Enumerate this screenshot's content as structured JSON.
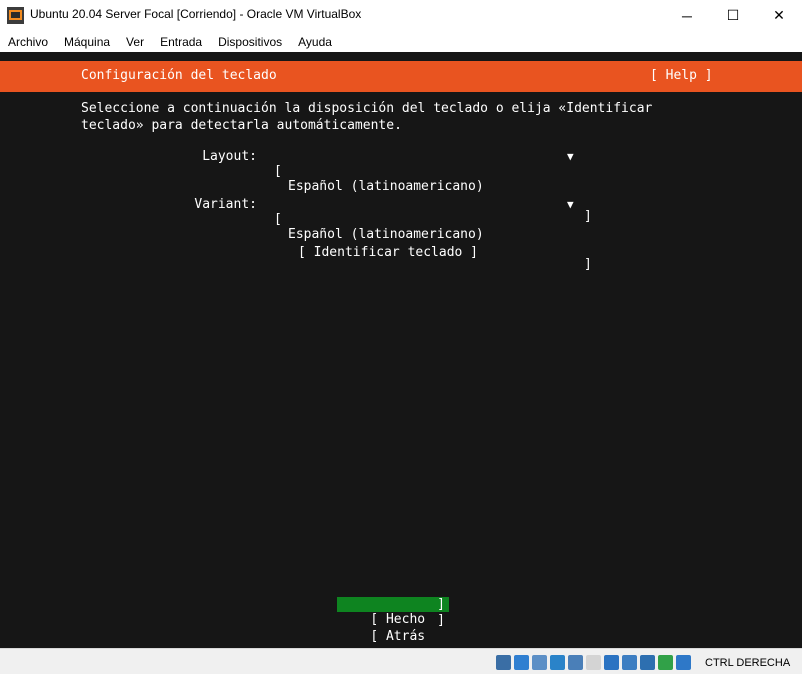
{
  "window": {
    "title": "Ubuntu 20.04 Server Focal [Corriendo] - Oracle VM VirtualBox",
    "minimize_glyph": "─",
    "maximize_glyph": "☐",
    "close_glyph": "✕"
  },
  "menu": [
    "Archivo",
    "Máquina",
    "Ver",
    "Entrada",
    "Dispositivos",
    "Ayuda"
  ],
  "installer": {
    "header_title": "Configuración del teclado",
    "help_label": "[ Help ]",
    "description": "Seleccione a continuación la disposición del teclado o elija «Identificar\nteclado» para detectarla automáticamente.",
    "layout": {
      "label": "Layout:",
      "value": "Español (latinoamericano)",
      "open": "[",
      "close": "]",
      "arrow": "▼"
    },
    "variant": {
      "label": "Variant:",
      "value": "Español (latinoamericano)",
      "open": "[",
      "close": "]",
      "arrow": "▼"
    },
    "identify_button": "[ Identificar teclado ]",
    "done_button": "[ Hecho",
    "back_button": "[ Atrás",
    "button_close": "]"
  },
  "statusbar": {
    "host_key": "CTRL DERECHA",
    "icons": [
      {
        "name": "hard-disk-icon",
        "color": "#3a6ea5"
      },
      {
        "name": "optical-drive-icon",
        "color": "#2f7fd1"
      },
      {
        "name": "audio-icon",
        "color": "#5c8fc6"
      },
      {
        "name": "network-icon",
        "color": "#2a83c9"
      },
      {
        "name": "usb-icon",
        "color": "#4a7fb8"
      },
      {
        "name": "shared-folders-icon",
        "color": "#d4d4d4"
      },
      {
        "name": "display-icon",
        "color": "#2b73c2"
      },
      {
        "name": "video-capture-icon",
        "color": "#3d7ec2"
      },
      {
        "name": "virtualization-icon",
        "color": "#2d6fb0"
      },
      {
        "name": "guest-additions-icon",
        "color": "#31a148"
      },
      {
        "name": "download-icon",
        "color": "#2e78c8"
      }
    ]
  }
}
